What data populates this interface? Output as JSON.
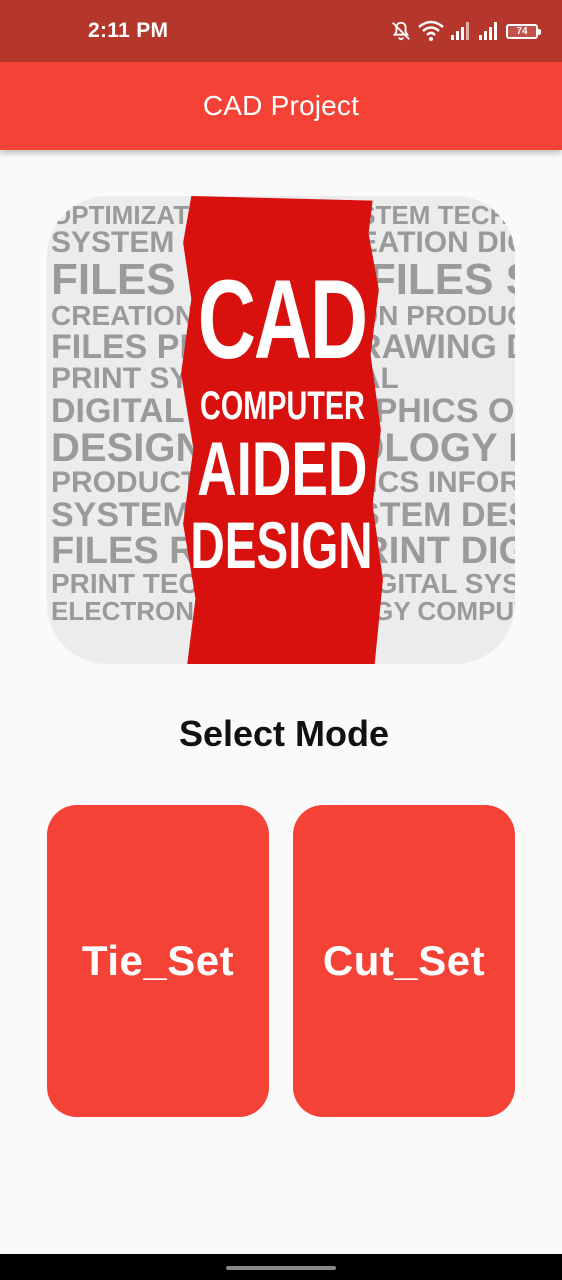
{
  "status_bar": {
    "time": "2:11 PM",
    "battery_level": "74",
    "icons": [
      "notifications-off-icon",
      "wifi-icon",
      "signal-icon",
      "signal-icon",
      "battery-icon"
    ]
  },
  "app_bar": {
    "title": "CAD Project",
    "color": "#f44336"
  },
  "hero_image": {
    "banner_lines": [
      "CAD",
      "COMPUTER",
      "AIDED",
      "DESIGN"
    ],
    "word_cloud": [
      "OPTIMIZATION FILES SYSTEM TECHNOLOGY",
      "SYSTEM RASTER CREATION DIGITAL",
      "FILES DESIGN FILES SYSTEM",
      "CREATION INFORMATION PRODUCTION",
      "FILES PROCESS DRAWING DESIGN",
      "PRINT SYSTEM DIGITAL",
      "DIGITAL FILES GRAPHICS OPTIMIZATION",
      "DESIGN TECHNOLOGY RASTER PRINT",
      "PRODUCTION GRAPHICS INFORMATION",
      "SYSTEM PRINT SYSTEM DESIGN",
      "FILES RASTER PRINT DIGITAL",
      "PRINT TECHNOLOGY DIGITAL SYSTEM",
      "ELECTRONIC TECHNOLOGY COMPUTER CREATION"
    ]
  },
  "heading": "Select Mode",
  "modes": [
    {
      "label": "Tie_Set"
    },
    {
      "label": "Cut_Set"
    }
  ],
  "colors": {
    "status_bar": "#b5372c",
    "accent": "#f44336",
    "background": "#fafafa"
  }
}
